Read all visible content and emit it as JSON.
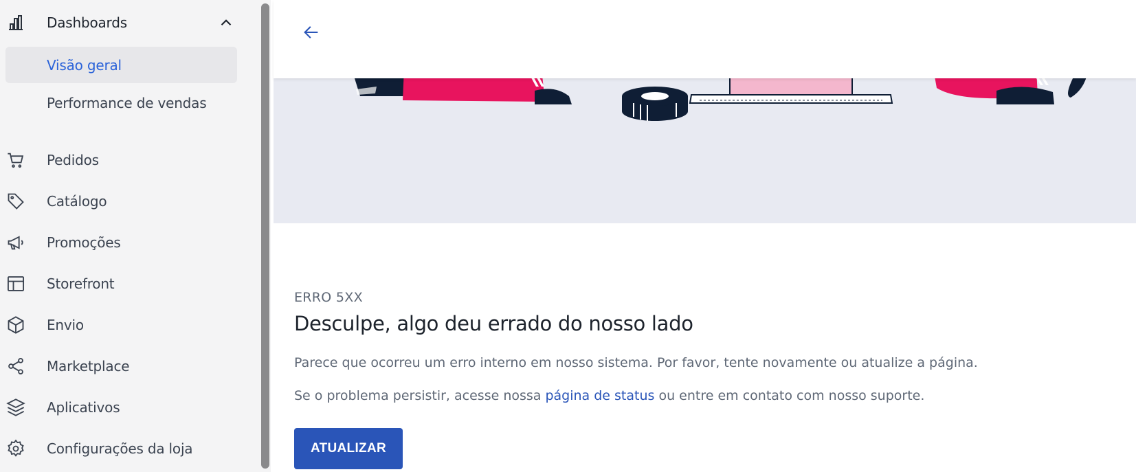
{
  "sidebar": {
    "header": {
      "label": "Dashboards",
      "icon": "bar-chart-icon"
    },
    "subitems": [
      {
        "label": "Visão geral",
        "active": true
      },
      {
        "label": "Performance de vendas",
        "active": false
      }
    ],
    "items": [
      {
        "label": "Pedidos",
        "icon": "cart-icon"
      },
      {
        "label": "Catálogo",
        "icon": "tag-icon"
      },
      {
        "label": "Promoções",
        "icon": "megaphone-icon"
      },
      {
        "label": "Storefront",
        "icon": "layout-icon"
      },
      {
        "label": "Envio",
        "icon": "box-icon"
      },
      {
        "label": "Marketplace",
        "icon": "share-icon"
      },
      {
        "label": "Aplicativos",
        "icon": "layers-icon"
      },
      {
        "label": "Configurações da loja",
        "icon": "gear-icon"
      }
    ]
  },
  "error": {
    "code": "ERRO 5XX",
    "title": "Desculpe, algo deu errado do nosso lado",
    "paragraph1": "Parece que ocorreu um erro interno em nosso sistema. Por favor, tente novamente ou atualize a página.",
    "paragraph2_before": "Se o problema persistir, acesse nossa ",
    "paragraph2_link": "página de status",
    "paragraph2_after": " ou entre em contato com nosso suporte.",
    "button_label": "ATUALIZAR"
  },
  "colors": {
    "accent": "#2a55b8",
    "active_text": "#2b63d9",
    "hero_bg": "#e8eaf2",
    "illustration_pink": "#e8145e",
    "illustration_navy": "#0f1e35"
  }
}
